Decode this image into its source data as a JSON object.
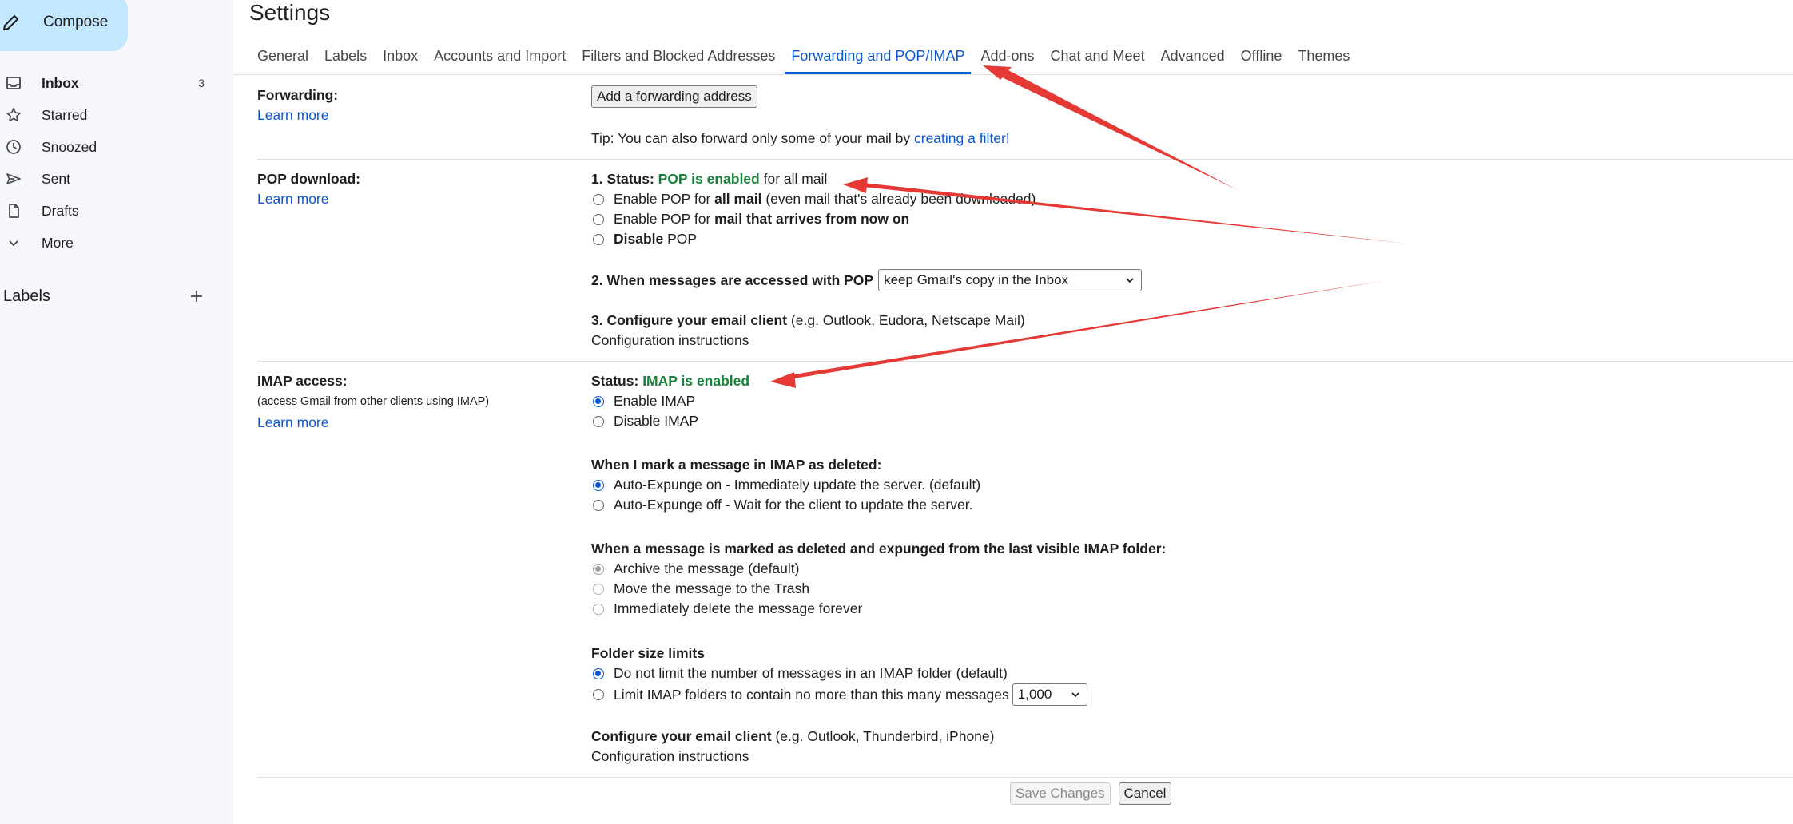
{
  "sidebar": {
    "compose_label": "Compose",
    "items": [
      {
        "label": "Inbox",
        "count": "3"
      },
      {
        "label": "Starred"
      },
      {
        "label": "Snoozed"
      },
      {
        "label": "Sent"
      },
      {
        "label": "Drafts"
      },
      {
        "label": "More"
      }
    ],
    "labels_title": "Labels"
  },
  "page_title": "Settings",
  "tabs": [
    "General",
    "Labels",
    "Inbox",
    "Accounts and Import",
    "Filters and Blocked Addresses",
    "Forwarding and POP/IMAP",
    "Add-ons",
    "Chat and Meet",
    "Advanced",
    "Offline",
    "Themes"
  ],
  "active_tab": "Forwarding and POP/IMAP",
  "forwarding": {
    "label": "Forwarding:",
    "learn_more": "Learn more",
    "add_button": "Add a forwarding address",
    "tip_text": "Tip: You can also forward only some of your mail by ",
    "tip_link": "creating a filter!"
  },
  "pop": {
    "label": "POP download:",
    "learn_more": "Learn more",
    "status_prefix": "1. Status: ",
    "status_value": "POP is enabled",
    "status_suffix": " for all mail",
    "options": [
      {
        "pre": "Enable POP for ",
        "bold": "all mail",
        "post": " (even mail that's already been downloaded)",
        "checked": false
      },
      {
        "pre": "Enable POP for ",
        "bold": "mail that arrives from now on",
        "post": "",
        "checked": false
      },
      {
        "pre": "",
        "bold": "Disable",
        "post": " POP",
        "checked": false
      }
    ],
    "access_label": "2. When messages are accessed with POP",
    "access_value": "keep Gmail's copy in the Inbox",
    "configure_label": "3. Configure your email client",
    "configure_hint": " (e.g. Outlook, Eudora, Netscape Mail)",
    "config_link": "Configuration instructions"
  },
  "imap": {
    "label": "IMAP access:",
    "sublabel": "(access Gmail from other clients using IMAP)",
    "learn_more": "Learn more",
    "status_prefix": "Status: ",
    "status_value": "IMAP is enabled",
    "enable_options": [
      {
        "label": "Enable IMAP",
        "checked": true
      },
      {
        "label": "Disable IMAP",
        "checked": false
      }
    ],
    "deleted_heading": "When I mark a message in IMAP as deleted:",
    "deleted_options": [
      {
        "label": "Auto-Expunge on - Immediately update the server. (default)",
        "checked": true
      },
      {
        "label": "Auto-Expunge off - Wait for the client to update the server.",
        "checked": false
      }
    ],
    "expunged_heading": "When a message is marked as deleted and expunged from the last visible IMAP folder:",
    "expunged_options": [
      {
        "label": "Archive the message (default)",
        "checked": true
      },
      {
        "label": "Move the message to the Trash",
        "checked": false
      },
      {
        "label": "Immediately delete the message forever",
        "checked": false
      }
    ],
    "folder_heading": "Folder size limits",
    "folder_options": [
      {
        "label": "Do not limit the number of messages in an IMAP folder (default)",
        "checked": true
      },
      {
        "label": "Limit IMAP folders to contain no more than this many messages",
        "checked": false
      }
    ],
    "folder_limit_value": "1,000",
    "configure_label": "Configure your email client",
    "configure_hint": " (e.g. Outlook, Thunderbird, iPhone)",
    "config_link": "Configuration instructions"
  },
  "actions": {
    "save": "Save Changes",
    "cancel": "Cancel"
  },
  "colors": {
    "accent": "#0b57d0",
    "status_green": "#188038",
    "annotation_arrow": "#e53935",
    "compose_bg": "#c2e7ff"
  }
}
